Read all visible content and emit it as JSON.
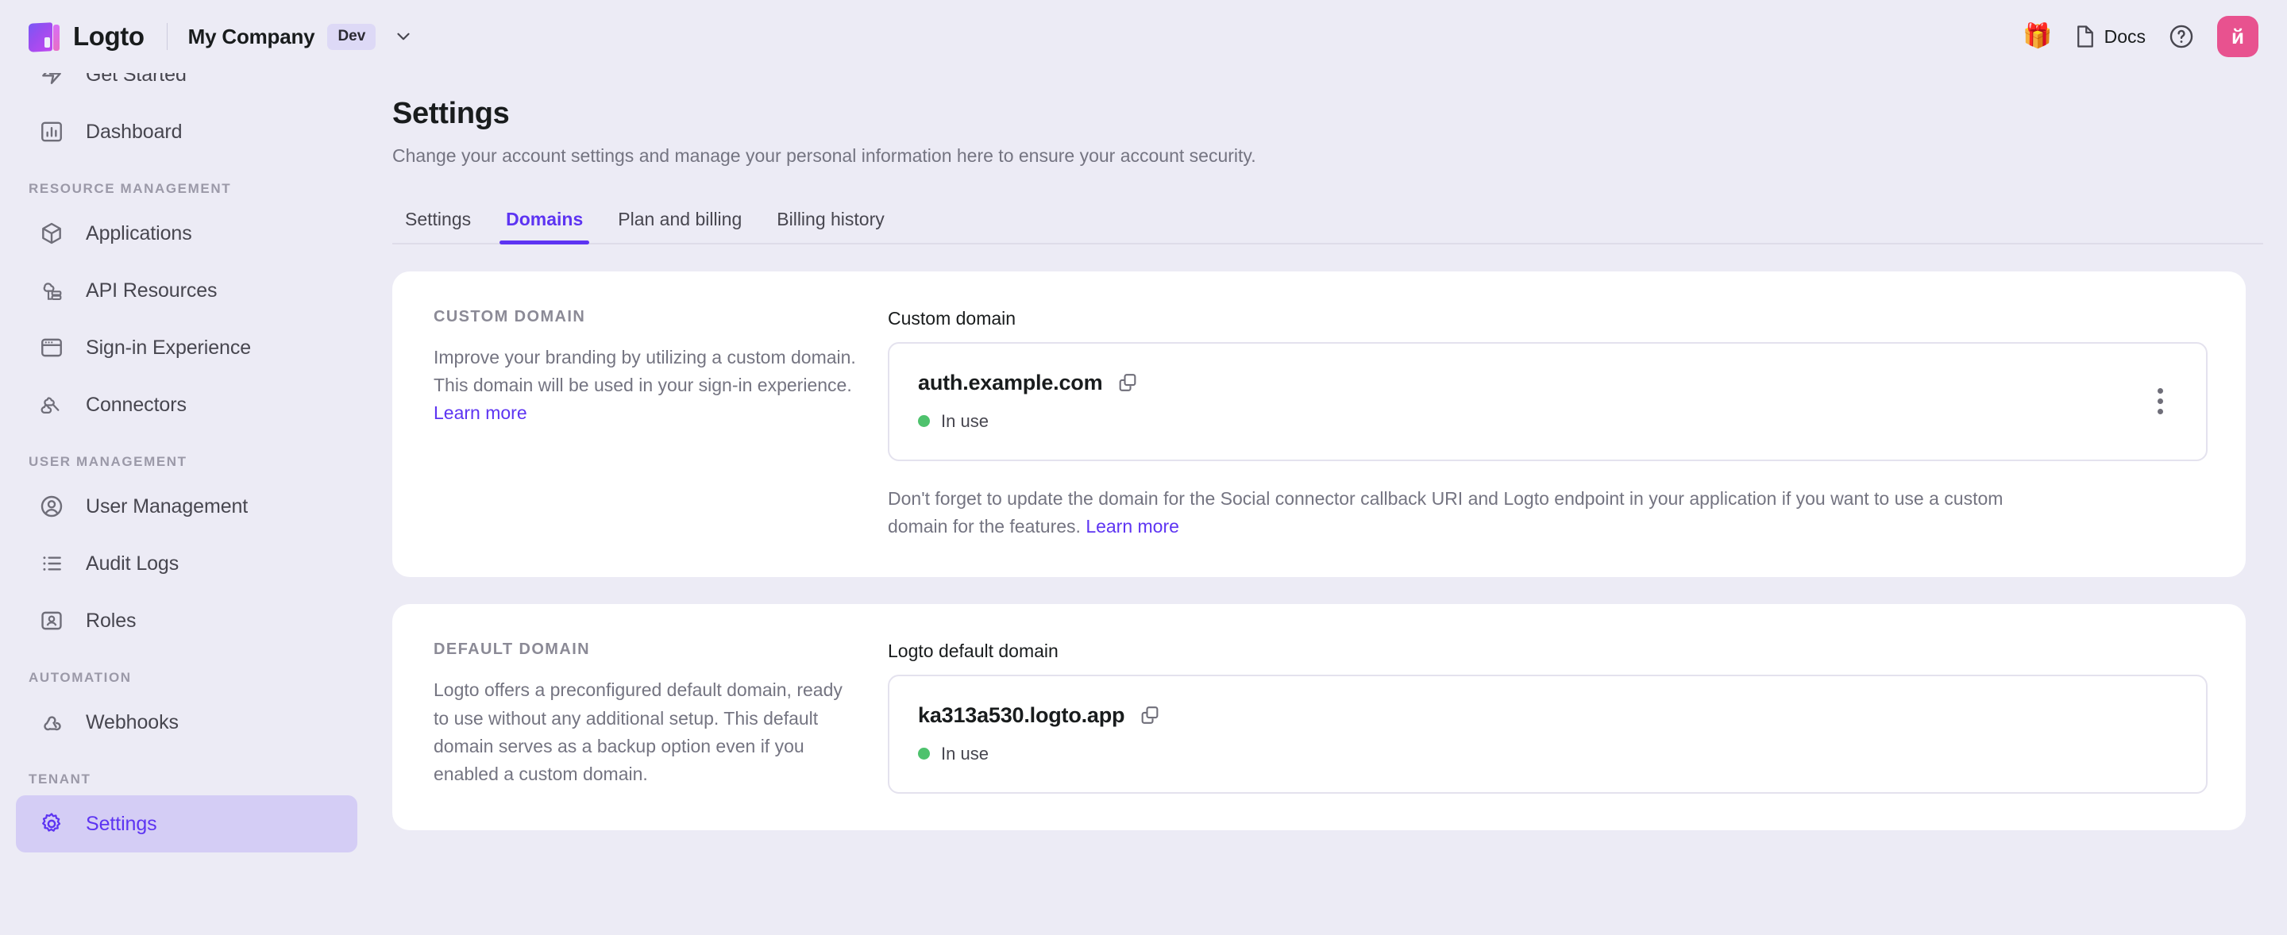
{
  "header": {
    "product_name": "Logto",
    "tenant_name": "My Company",
    "env_badge": "Dev",
    "gift_icon": "gift-icon",
    "docs_label": "Docs",
    "avatar_initial": "й"
  },
  "sidebar": {
    "groups": [
      {
        "label": null,
        "items": [
          {
            "label": "Get Started",
            "icon": "rocket-icon",
            "active": false
          },
          {
            "label": "Dashboard",
            "icon": "chart-bar-icon",
            "active": false
          }
        ]
      },
      {
        "label": "RESOURCE MANAGEMENT",
        "items": [
          {
            "label": "Applications",
            "icon": "cube-icon",
            "active": false
          },
          {
            "label": "API Resources",
            "icon": "api-icon",
            "active": false
          },
          {
            "label": "Sign-in Experience",
            "icon": "window-icon",
            "active": false
          },
          {
            "label": "Connectors",
            "icon": "connector-icon",
            "active": false
          }
        ]
      },
      {
        "label": "USER MANAGEMENT",
        "items": [
          {
            "label": "User Management",
            "icon": "user-circle-icon",
            "active": false
          },
          {
            "label": "Audit Logs",
            "icon": "list-icon",
            "active": false
          },
          {
            "label": "Roles",
            "icon": "id-card-icon",
            "active": false
          }
        ]
      },
      {
        "label": "AUTOMATION",
        "items": [
          {
            "label": "Webhooks",
            "icon": "webhook-icon",
            "active": false
          }
        ]
      },
      {
        "label": "TENANT",
        "items": [
          {
            "label": "Settings",
            "icon": "gear-icon",
            "active": true
          }
        ]
      }
    ]
  },
  "main": {
    "title": "Settings",
    "subtitle": "Change your account settings and manage your personal information here to ensure your account security.",
    "tabs": [
      {
        "label": "Settings",
        "active": false
      },
      {
        "label": "Domains",
        "active": true
      },
      {
        "label": "Plan and billing",
        "active": false
      },
      {
        "label": "Billing history",
        "active": false
      }
    ],
    "cards": [
      {
        "eyebrow": "CUSTOM DOMAIN",
        "description": "Improve your branding by utilizing a custom domain. This domain will be used in your sign-in experience. ",
        "description_link": "Learn more",
        "field_label": "Custom domain",
        "domain": "auth.example.com",
        "status": "In use",
        "status_color": "#4ec26d",
        "has_kebab": true,
        "note": "Don't forget to update the domain for the Social connector callback URI and Logto endpoint in your application if you want to use a custom domain for the features. ",
        "note_link": "Learn more"
      },
      {
        "eyebrow": "DEFAULT DOMAIN",
        "description": "Logto offers a preconfigured default domain, ready to use without any additional setup. This default domain serves as a backup option even if you enabled a custom domain.",
        "description_link": "",
        "field_label": "Logto default domain",
        "domain": "ka313a530.logto.app",
        "status": "In use",
        "status_color": "#4ec26d",
        "has_kebab": false,
        "note": "",
        "note_link": ""
      }
    ]
  },
  "colors": {
    "accent": "#5d34f2",
    "page_bg": "#ecebf5",
    "card_bg": "#ffffff",
    "status_green": "#4ec26d",
    "avatar_bg": "#e8528f"
  }
}
